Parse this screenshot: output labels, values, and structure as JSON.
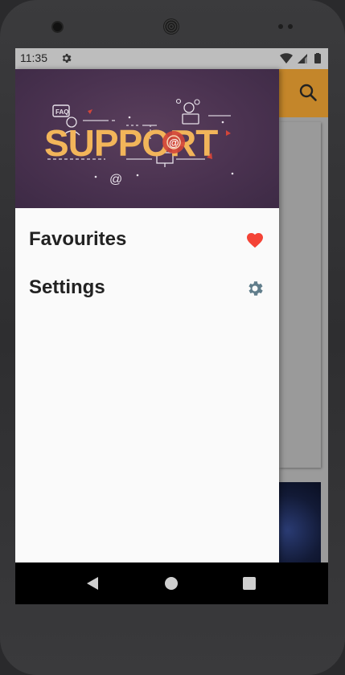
{
  "status_bar": {
    "time": "11:35",
    "settings_icon": "gear-icon",
    "icons": [
      "wifi-icon",
      "signal-icon",
      "battery-icon"
    ]
  },
  "app_bar": {
    "search_icon": "search-icon",
    "accent_color": "#c4862a"
  },
  "drawer": {
    "header": {
      "banner_text": "SUPPORT",
      "banner_small_labels": [
        "FAQ",
        "@",
        "@"
      ],
      "background_color": "#4a3250",
      "text_color": "#f2b55a"
    },
    "items": [
      {
        "label": "Favourites",
        "icon": "heart-icon",
        "icon_color": "#f44336"
      },
      {
        "label": "Settings",
        "icon": "gear-icon",
        "icon_color": "#607d8b"
      }
    ]
  },
  "nav_bar": {
    "buttons": [
      "back-button",
      "home-button",
      "recents-button"
    ]
  }
}
